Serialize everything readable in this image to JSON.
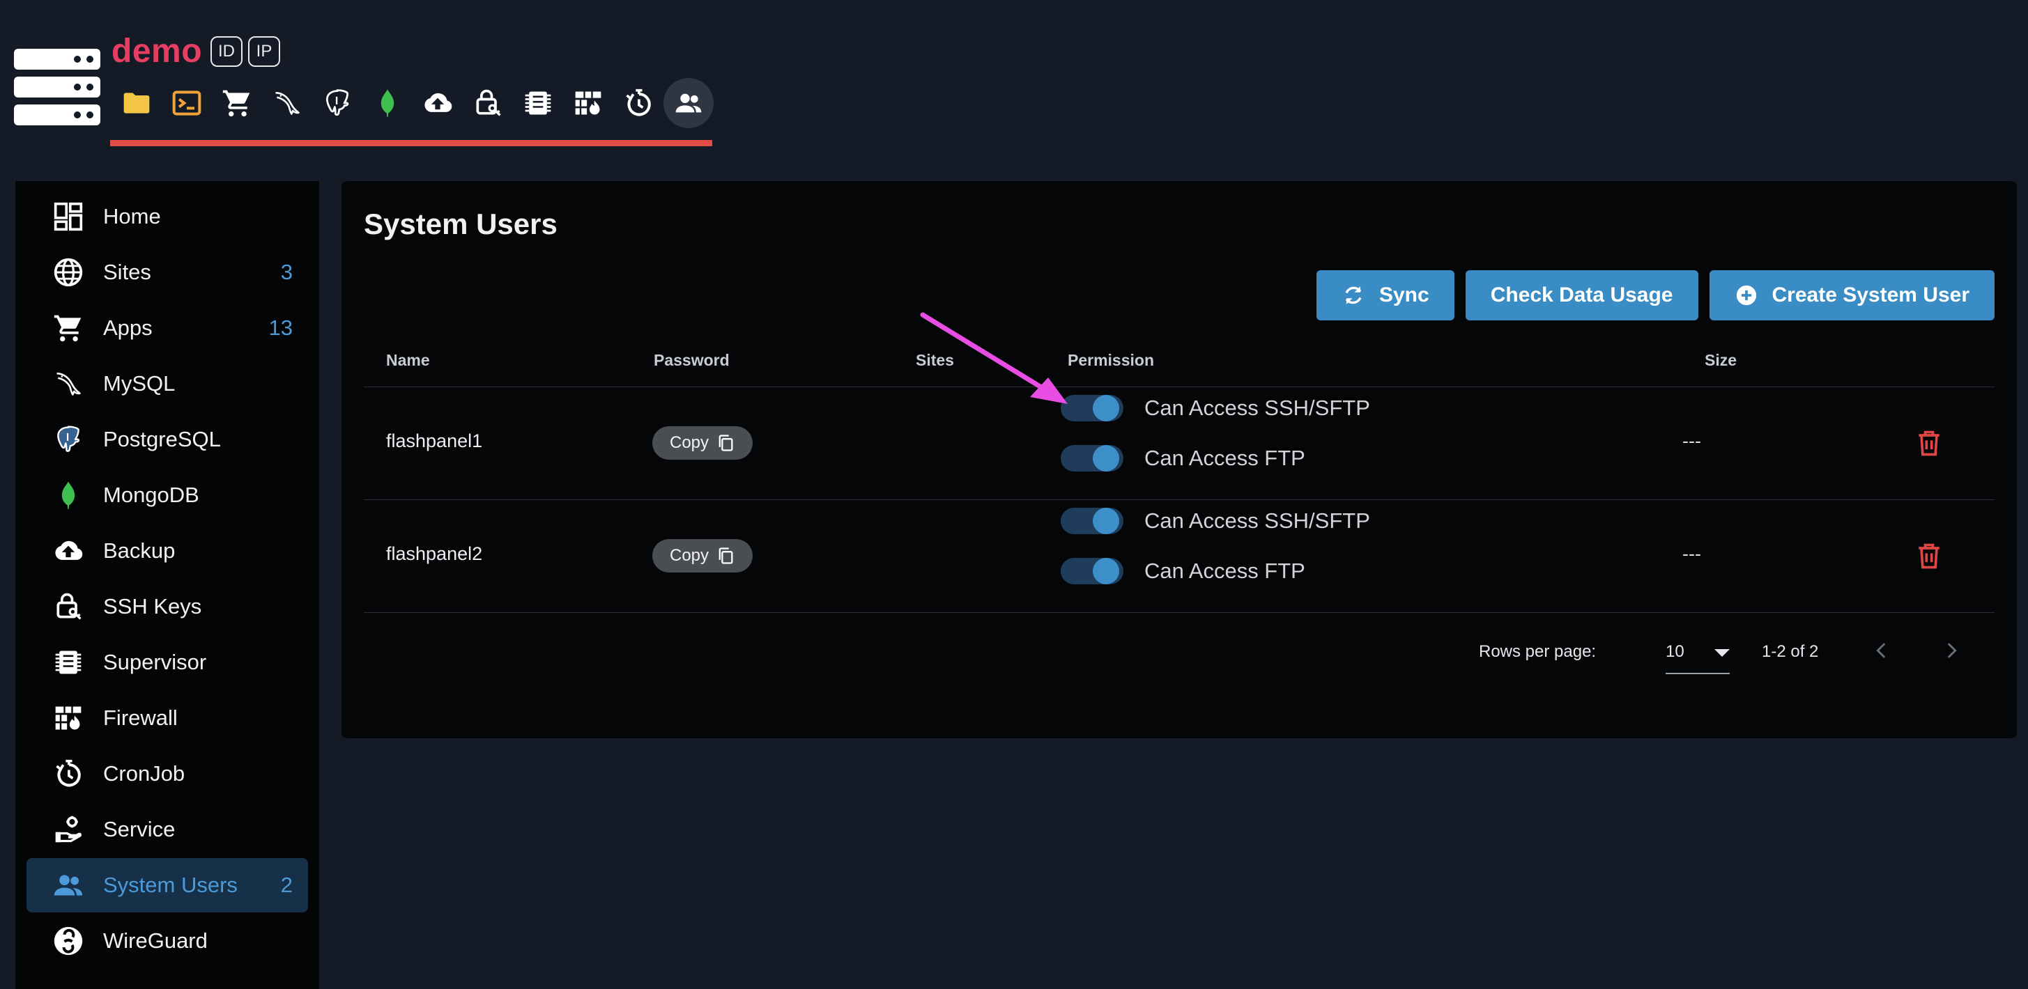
{
  "header": {
    "brand": "demo",
    "badges": [
      "ID",
      "IP"
    ],
    "toolbar": [
      {
        "icon": "folder-icon",
        "color": "#f2c544"
      },
      {
        "icon": "terminal-icon",
        "color": "#f0a33a"
      },
      {
        "icon": "cart-icon",
        "color": "#ffffff"
      },
      {
        "icon": "mysql-dolphin-icon",
        "color": "#ffffff"
      },
      {
        "icon": "postgresql-elephant-icon",
        "color": "#ffffff"
      },
      {
        "icon": "mongodb-leaf-icon",
        "color": "#3fbf4f"
      },
      {
        "icon": "cloud-upload-icon",
        "color": "#ffffff"
      },
      {
        "icon": "lock-key-icon",
        "color": "#ffffff"
      },
      {
        "icon": "supervisor-chip-icon",
        "color": "#ffffff"
      },
      {
        "icon": "firewall-icon",
        "color": "#ffffff"
      },
      {
        "icon": "cronjob-timer-icon",
        "color": "#ffffff"
      },
      {
        "icon": "users-icon",
        "color": "#ffffff",
        "active": true
      }
    ],
    "accent_color": "#e24d47",
    "brand_color": "#e63e62"
  },
  "sidebar": {
    "items": [
      {
        "label": "Home",
        "icon": "dashboard-icon",
        "count": ""
      },
      {
        "label": "Sites",
        "icon": "globe-icon",
        "count": "3"
      },
      {
        "label": "Apps",
        "icon": "cart-icon",
        "count": "13"
      },
      {
        "label": "MySQL",
        "icon": "mysql-dolphin-icon",
        "count": ""
      },
      {
        "label": "PostgreSQL",
        "icon": "postgresql-elephant-icon",
        "count": ""
      },
      {
        "label": "MongoDB",
        "icon": "mongodb-leaf-icon",
        "count": ""
      },
      {
        "label": "Backup",
        "icon": "cloud-upload-icon",
        "count": ""
      },
      {
        "label": "SSH Keys",
        "icon": "lock-key-icon",
        "count": ""
      },
      {
        "label": "Supervisor",
        "icon": "supervisor-chip-icon",
        "count": ""
      },
      {
        "label": "Firewall",
        "icon": "firewall-icon",
        "count": ""
      },
      {
        "label": "CronJob",
        "icon": "cronjob-timer-icon",
        "count": ""
      },
      {
        "label": "Service",
        "icon": "service-icon",
        "count": ""
      },
      {
        "label": "System Users",
        "icon": "users-icon",
        "count": "2",
        "active": true
      },
      {
        "label": "WireGuard",
        "icon": "wireguard-icon",
        "count": ""
      }
    ]
  },
  "main": {
    "title": "System Users",
    "buttons": {
      "sync": "Sync",
      "check_data_usage": "Check Data Usage",
      "create_system_user": "Create System User"
    },
    "columns": [
      "Name",
      "Password",
      "Sites",
      "Permission",
      "Size"
    ],
    "rows": [
      {
        "name": "flashpanel1",
        "password_button": "Copy",
        "permissions": [
          {
            "label": "Can Access SSH/SFTP",
            "enabled": true
          },
          {
            "label": "Can Access FTP",
            "enabled": true
          }
        ],
        "size": "---"
      },
      {
        "name": "flashpanel2",
        "password_button": "Copy",
        "permissions": [
          {
            "label": "Can Access SSH/SFTP",
            "enabled": true
          },
          {
            "label": "Can Access FTP",
            "enabled": true
          }
        ],
        "size": "---"
      }
    ],
    "pagination": {
      "rows_per_page_label": "Rows per page:",
      "rows_per_page": "10",
      "range": "1-2 of 2"
    },
    "primary_color": "#3a8dc4",
    "danger_color": "#e04646",
    "annotation_arrow_color": "#e84ee3"
  }
}
